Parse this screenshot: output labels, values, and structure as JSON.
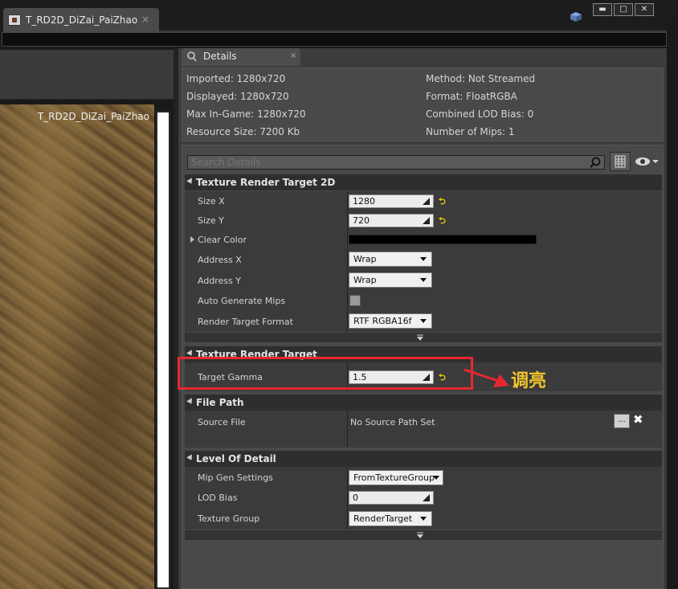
{
  "document_tab": {
    "title": "T_RD2D_DiZai_PaiZhao",
    "close_glyph": "×"
  },
  "window_buttons": {
    "minimize": "▬",
    "maximize": "□",
    "close": "✕"
  },
  "viewport": {
    "title": "T_RD2D_DiZai_PaiZhao"
  },
  "details_tab": {
    "label": "Details",
    "close_glyph": "×"
  },
  "info": {
    "imported": "Imported: 1280x720",
    "displayed": "Displayed: 1280x720",
    "max_in_game": "Max In-Game: 1280x720",
    "resource_size": "Resource Size: 7200 Kb",
    "method": "Method: Not Streamed",
    "format": "Format: FloatRGBA",
    "combined_lod_bias": "Combined LOD Bias: 0",
    "number_of_mips": "Number of Mips: 1"
  },
  "search": {
    "placeholder": "Search Details"
  },
  "sections": {
    "trt2d": {
      "title": "Texture Render Target 2D",
      "size_x_label": "Size X",
      "size_x_value": "1280",
      "size_y_label": "Size Y",
      "size_y_value": "720",
      "clear_color_label": "Clear Color",
      "address_x_label": "Address X",
      "address_x_value": "Wrap",
      "address_y_label": "Address Y",
      "address_y_value": "Wrap",
      "auto_mips_label": "Auto Generate Mips",
      "format_label": "Render Target Format",
      "format_value": "RTF RGBA16f"
    },
    "trt": {
      "title": "Texture Render Target",
      "gamma_label": "Target Gamma",
      "gamma_value": "1.5"
    },
    "file_path": {
      "title": "File Path",
      "source_label": "Source File",
      "source_value": "No Source Path Set",
      "browse_label": "..."
    },
    "lod": {
      "title": "Level Of Detail",
      "mip_gen_label": "Mip Gen Settings",
      "mip_gen_value": "FromTextureGroup",
      "lod_bias_label": "LOD Bias",
      "lod_bias_value": "0",
      "texture_group_label": "Texture Group",
      "texture_group_value": "RenderTarget"
    }
  },
  "annotation": {
    "text": "调亮",
    "color": "#e8282f"
  },
  "reset_glyph": "⮌",
  "clear_glyph": "✖"
}
